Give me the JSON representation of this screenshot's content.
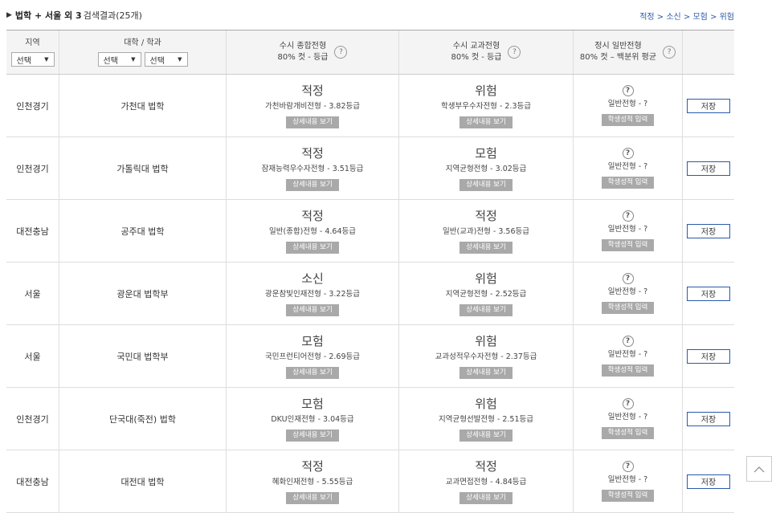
{
  "summary": {
    "tri": "▶",
    "bold": "법학 + 서울 외 3",
    "text": "검색결과(25개)"
  },
  "legend": "적정 > 소신 > 모험 > 위험",
  "header": {
    "region": "지역",
    "region_select": "선택",
    "uni": "대학 / 학과",
    "uni_select1": "선택",
    "uni_select2": "선택",
    "comp_title": "수시 종합전형",
    "comp_sub": "80% 컷 - 등급",
    "sub_title": "수시 교과전형",
    "sub_sub": "80% 컷 - 등급",
    "reg_title": "정시 일반전형",
    "reg_sub": "80% 컷 – 백분위 평균",
    "help": "?"
  },
  "labels": {
    "detail_btn": "상세내용 보기",
    "input_btn": "학생성적 입력",
    "save": "저장",
    "regular_q": "?",
    "regular_text": "일반전형 - ?"
  },
  "rows": [
    {
      "region": "인천경기",
      "uni": "가천대 법학",
      "comp_result": "적정",
      "comp_detail": "가천바람개비전형 - 3.82등급",
      "sub_result": "위험",
      "sub_detail": "학생부우수자전형 - 2.3등급"
    },
    {
      "region": "인천경기",
      "uni": "가톨릭대 법학",
      "comp_result": "적정",
      "comp_detail": "잠재능력우수자전형 - 3.51등급",
      "sub_result": "모험",
      "sub_detail": "지역균형전형 - 3.02등급"
    },
    {
      "region": "대전충남",
      "uni": "공주대 법학",
      "comp_result": "적정",
      "comp_detail": "일반(종합)전형 - 4.64등급",
      "sub_result": "적정",
      "sub_detail": "일반(교과)전형 - 3.56등급"
    },
    {
      "region": "서울",
      "uni": "광운대 법학부",
      "comp_result": "소신",
      "comp_detail": "광운참빛인재전형 - 3.22등급",
      "sub_result": "위험",
      "sub_detail": "지역균형전형 - 2.52등급"
    },
    {
      "region": "서울",
      "uni": "국민대 법학부",
      "comp_result": "모험",
      "comp_detail": "국민프런티어전형 - 2.69등급",
      "sub_result": "위험",
      "sub_detail": "교과성적우수자전형 - 2.37등급"
    },
    {
      "region": "인천경기",
      "uni": "단국대(죽전) 법학",
      "comp_result": "모험",
      "comp_detail": "DKU인재전형 - 3.04등급",
      "sub_result": "위험",
      "sub_detail": "지역균형선발전형 - 2.51등급"
    },
    {
      "region": "대전충남",
      "uni": "대전대 법학",
      "comp_result": "적정",
      "comp_detail": "혜화인재전형 - 5.55등급",
      "sub_result": "적정",
      "sub_detail": "교과면접전형 - 4.84등급"
    }
  ]
}
